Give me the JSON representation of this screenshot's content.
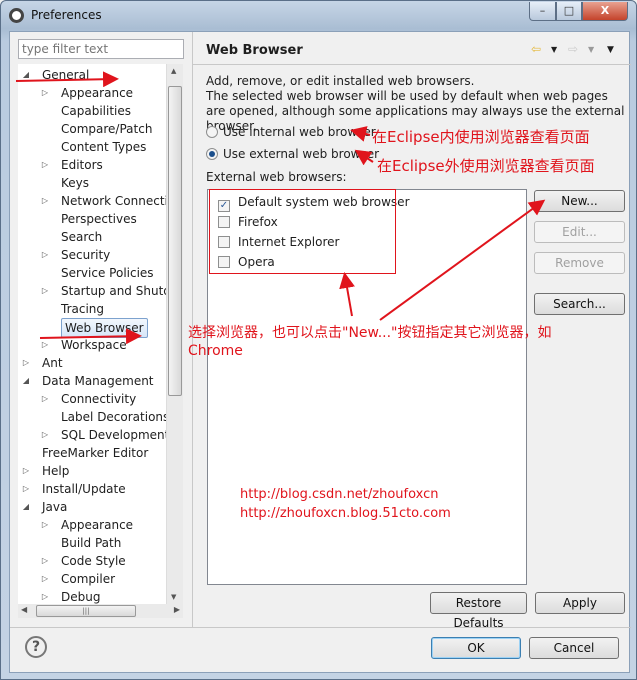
{
  "window": {
    "title": "Preferences",
    "minimize": "–",
    "maximize": "□",
    "close": "X"
  },
  "filter": {
    "placeholder": "type filter text"
  },
  "tree": [
    {
      "label": "General",
      "level": 0,
      "expander": "expanded"
    },
    {
      "label": "Appearance",
      "level": 1,
      "expander": "collapsed"
    },
    {
      "label": "Capabilities",
      "level": 1,
      "expander": "none"
    },
    {
      "label": "Compare/Patch",
      "level": 1,
      "expander": "none"
    },
    {
      "label": "Content Types",
      "level": 1,
      "expander": "none"
    },
    {
      "label": "Editors",
      "level": 1,
      "expander": "collapsed"
    },
    {
      "label": "Keys",
      "level": 1,
      "expander": "none"
    },
    {
      "label": "Network Connections",
      "level": 1,
      "expander": "collapsed"
    },
    {
      "label": "Perspectives",
      "level": 1,
      "expander": "none"
    },
    {
      "label": "Search",
      "level": 1,
      "expander": "none"
    },
    {
      "label": "Security",
      "level": 1,
      "expander": "collapsed"
    },
    {
      "label": "Service Policies",
      "level": 1,
      "expander": "none"
    },
    {
      "label": "Startup and Shutdown",
      "level": 1,
      "expander": "collapsed"
    },
    {
      "label": "Tracing",
      "level": 1,
      "expander": "none"
    },
    {
      "label": "Web Browser",
      "level": 1,
      "expander": "none",
      "selected": true
    },
    {
      "label": "Workspace",
      "level": 1,
      "expander": "collapsed"
    },
    {
      "label": "Ant",
      "level": 0,
      "expander": "collapsed"
    },
    {
      "label": "Data Management",
      "level": 0,
      "expander": "expanded"
    },
    {
      "label": "Connectivity",
      "level": 1,
      "expander": "collapsed"
    },
    {
      "label": "Label Decorations",
      "level": 1,
      "expander": "none"
    },
    {
      "label": "SQL Development",
      "level": 1,
      "expander": "collapsed"
    },
    {
      "label": "FreeMarker Editor",
      "level": 0,
      "expander": "none"
    },
    {
      "label": "Help",
      "level": 0,
      "expander": "collapsed"
    },
    {
      "label": "Install/Update",
      "level": 0,
      "expander": "collapsed"
    },
    {
      "label": "Java",
      "level": 0,
      "expander": "expanded"
    },
    {
      "label": "Appearance",
      "level": 1,
      "expander": "collapsed"
    },
    {
      "label": "Build Path",
      "level": 1,
      "expander": "none"
    },
    {
      "label": "Code Style",
      "level": 1,
      "expander": "collapsed"
    },
    {
      "label": "Compiler",
      "level": 1,
      "expander": "collapsed"
    },
    {
      "label": "Debug",
      "level": 1,
      "expander": "collapsed"
    }
  ],
  "page": {
    "title": "Web Browser",
    "desc1": "Add, remove, or edit installed web browsers.",
    "desc2": "The selected web browser will be used by default when web pages are opened, although some applications may always use the external browser.",
    "radio_internal": "Use internal web browser",
    "radio_external": "Use external web browser",
    "selected_radio": "external",
    "list_label": "External web browsers:",
    "browsers": [
      {
        "label": "Default system web browser",
        "checked": true
      },
      {
        "label": "Firefox",
        "checked": false
      },
      {
        "label": "Internet Explorer",
        "checked": false
      },
      {
        "label": "Opera",
        "checked": false
      }
    ],
    "buttons": {
      "new": "New...",
      "edit": "Edit...",
      "remove": "Remove",
      "search": "Search..."
    },
    "restore_defaults": "Restore Defaults",
    "apply": "Apply"
  },
  "dialog": {
    "ok": "OK",
    "cancel": "Cancel",
    "help": "?"
  },
  "annotations": {
    "internal": "在Eclipse内使用浏览器查看页面",
    "external": "在Eclipse外使用浏览器查看页面",
    "choose": "选择浏览器，也可以点击\"New...\"按钮指定其它浏览器，如",
    "choose2": "Chrome",
    "url1": "http://blog.csdn.net/zhoufoxcn",
    "url2": "http://zhoufoxcn.blog.51cto.com"
  },
  "colors": {
    "annotation": "#e0141c",
    "selection": "#d6e6f8"
  }
}
